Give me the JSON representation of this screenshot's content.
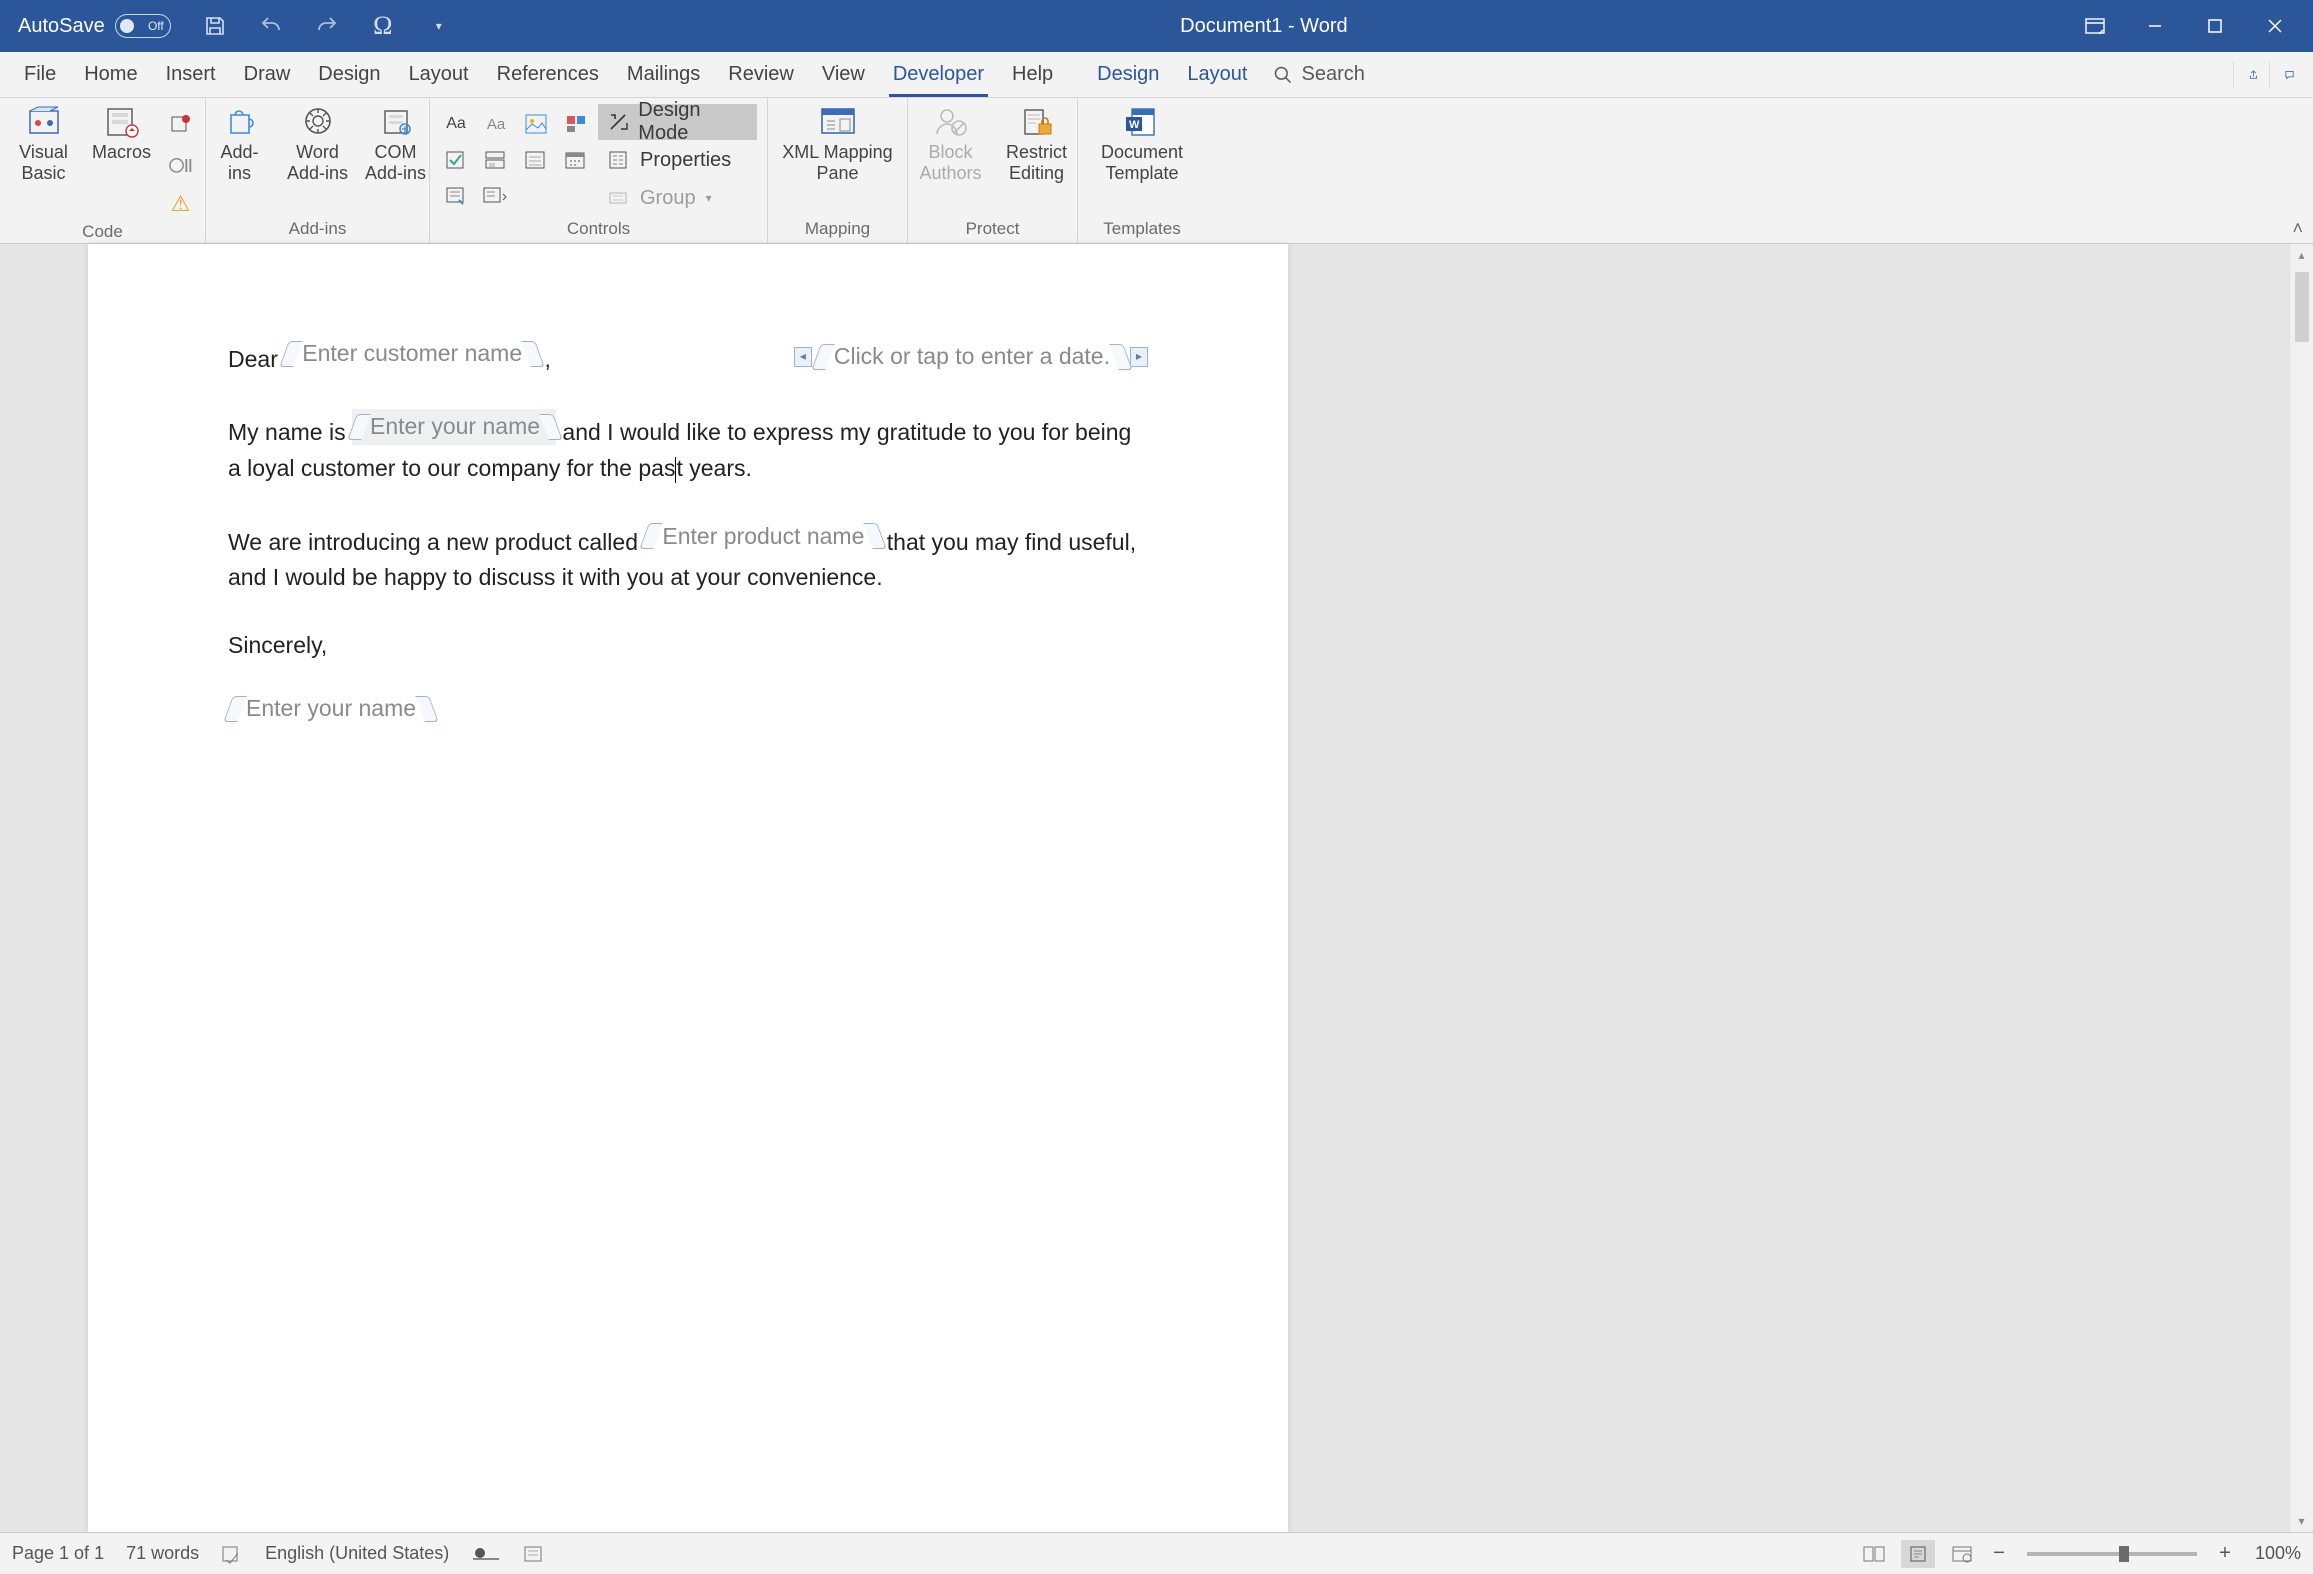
{
  "titlebar": {
    "autosave_label": "AutoSave",
    "autosave_state": "Off",
    "document_title": "Document1  -  Word"
  },
  "tabs": {
    "file": "File",
    "home": "Home",
    "insert": "Insert",
    "draw": "Draw",
    "design": "Design",
    "layout": "Layout",
    "references": "References",
    "mailings": "Mailings",
    "review": "Review",
    "view": "View",
    "developer": "Developer",
    "help": "Help",
    "table_design": "Design",
    "table_layout": "Layout",
    "search": "Search"
  },
  "ribbon": {
    "group_code": "Code",
    "visual_basic": "Visual\nBasic",
    "macros": "Macros",
    "group_addins": "Add-ins",
    "addins": "Add-\nins",
    "word_addins": "Word\nAdd-ins",
    "com_addins": "COM\nAdd-ins",
    "group_controls": "Controls",
    "design_mode": "Design Mode",
    "properties": "Properties",
    "group": "Group",
    "group_mapping": "Mapping",
    "xml_mapping": "XML Mapping\nPane",
    "group_protect": "Protect",
    "block_authors": "Block\nAuthors",
    "restrict_editing": "Restrict\nEditing",
    "group_templates": "Templates",
    "doc_template": "Document\nTemplate"
  },
  "document": {
    "dear": "Dear ",
    "cc_customer": "Enter customer name",
    "comma": " ,",
    "cc_date": "Click or tap to enter a date.",
    "p2a": "My name is ",
    "cc_yourname": "Enter your name",
    "p2b": " and I would like to express my gratitude to you for being a loyal customer to our company for the pas",
    "p2c": "t years.",
    "p3a": "We are introducing a new product called ",
    "cc_product": "Enter product name",
    "p3b": " that you may find useful, and I would be happy to discuss it with you at your convenience.",
    "sincerely": "Sincerely,",
    "cc_yourname2": "Enter your name"
  },
  "statusbar": {
    "page": "Page 1 of 1",
    "words": "71 words",
    "language": "English (United States)",
    "zoom": "100%"
  }
}
